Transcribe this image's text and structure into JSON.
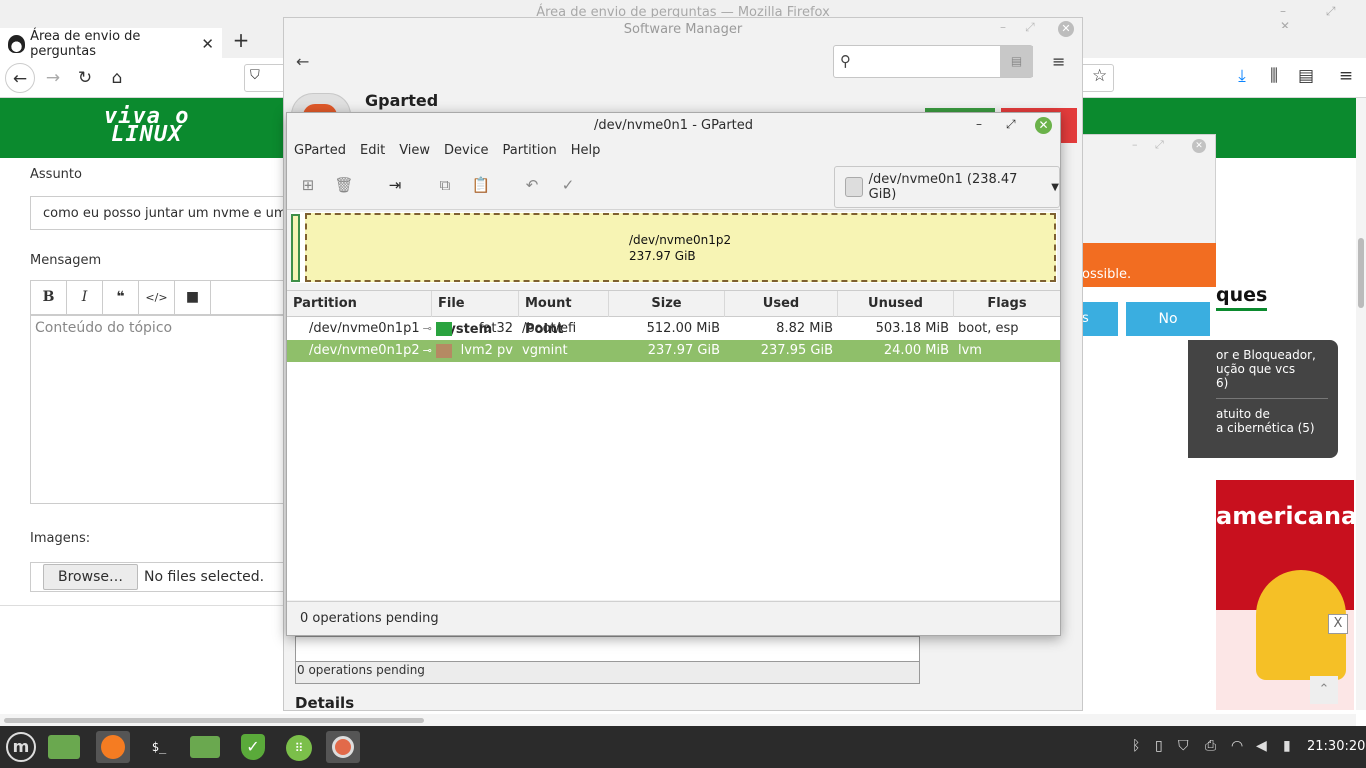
{
  "firefox": {
    "window_title": "Área de envio de perguntas — Mozilla Firefox",
    "tab_title": "Área de envio de perguntas",
    "tab_close": "✕",
    "new_tab": "+"
  },
  "site": {
    "logo_line1": "viva o",
    "logo_line2": "LINUX",
    "assunto_label": "Assunto",
    "assunto_value": "como eu posso juntar um nvme e um p",
    "mensagem_label": "Mensagem",
    "editor_buttons": [
      "B",
      "I",
      "❝",
      "</>",
      "■"
    ],
    "editor_placeholder": "Conteúdo do tópico",
    "imagens_label": "Imagens:",
    "browse_label": "Browse…",
    "no_files": "No files selected.",
    "orange_text": "ossible.",
    "blue_left_text": "s",
    "no_button": "No",
    "destaques_partial": "ques",
    "card_text_1": "or e Bloqueador,",
    "card_text_2": "ução que vcs",
    "card_text_3": "6)",
    "card_text_4": "atuito de",
    "card_text_5": "a cibernética (5)",
    "ad_text": "americana",
    "ad_close": "X"
  },
  "software_manager": {
    "title": "Software Manager",
    "app_name": "Gparted",
    "operations_pending": "0 operations pending",
    "details_label": "Details"
  },
  "gparted": {
    "title": "/dev/nvme0n1 - GParted",
    "menu": [
      "GParted",
      "Edit",
      "View",
      "Device",
      "Partition",
      "Help"
    ],
    "device_selector": "/dev/nvme0n1 (238.47 GiB)",
    "visual_name": "/dev/nvme0n1p2",
    "visual_size": "237.97 GiB",
    "columns": [
      "Partition",
      "File System",
      "Mount Point",
      "Size",
      "Used",
      "Unused",
      "Flags"
    ],
    "rows": [
      {
        "partition": "/dev/nvme0n1p1",
        "filesystem": "fat32",
        "fs_color": "#2aa33f",
        "mount": "/boot/efi",
        "size": "512.00 MiB",
        "used": "8.82 MiB",
        "unused": "503.18 MiB",
        "flags": "boot, esp"
      },
      {
        "partition": "/dev/nvme0n1p2",
        "filesystem": "lvm2 pv",
        "fs_color": "#b58a63",
        "mount": "vgmint",
        "size": "237.97 GiB",
        "used": "237.95 GiB",
        "unused": "24.00 MiB",
        "flags": "lvm"
      }
    ],
    "status": "0 operations pending"
  },
  "taskbar": {
    "clock": "21:30:20"
  }
}
